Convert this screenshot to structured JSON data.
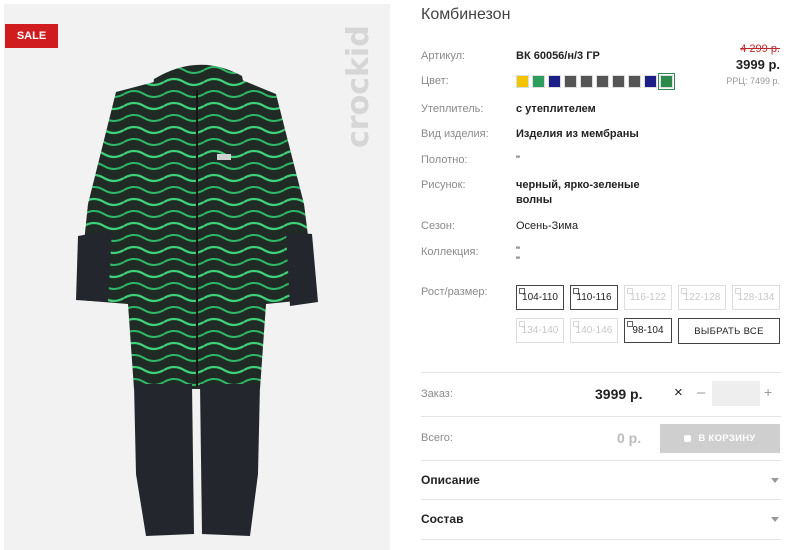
{
  "badge": {
    "sale": "SALE"
  },
  "brand": {
    "logo_text": "crockid"
  },
  "product": {
    "title": "Комбинезон",
    "attributes": [
      {
        "label": "Артикул:",
        "value": "ВК 60056/н/3 ГР"
      },
      {
        "label": "Цвет:",
        "value": ""
      },
      {
        "label": "Утеплитель:",
        "value": "с утеплителем"
      },
      {
        "label": "Вид изделия:",
        "value": "Изделия из мембраны"
      },
      {
        "label": "Полотно:",
        "value": "\""
      },
      {
        "label": "Рисунок:",
        "value_line1": "черный, ярко-зеленые",
        "value_line2": "волны"
      },
      {
        "label": "Сезон:",
        "value": "Осень-Зима"
      },
      {
        "label": "Коллекция:",
        "value_line1": "\"",
        "value_line2": "\""
      }
    ],
    "colors": [
      "#f2c500",
      "#2e9e5e",
      "#1c1f85",
      "#555555",
      "#555555",
      "#555555",
      "#555555",
      "#555555",
      "#1c1f85",
      "#2d8a4e"
    ],
    "active_color_index": 9
  },
  "price": {
    "old": "4 299 р.",
    "current": "3999 р.",
    "rrp": "РРЦ: 7499 р."
  },
  "sizes": {
    "label": "Рост/размер:",
    "row1": [
      {
        "label": "104-110",
        "available": true
      },
      {
        "label": "110-116",
        "available": true
      },
      {
        "label": "116-122",
        "available": false
      },
      {
        "label": "122-128",
        "available": false
      },
      {
        "label": "128-134",
        "available": false
      }
    ],
    "row2": [
      {
        "label": "134-140",
        "available": false
      },
      {
        "label": "140-146",
        "available": false
      },
      {
        "label": "98-104",
        "available": true
      }
    ],
    "select_all": "ВЫБРАТЬ ВСЕ"
  },
  "order": {
    "label": "Заказ:",
    "price": "3999 р.",
    "times": "×",
    "minus": "–",
    "plus": "+",
    "quantity": ""
  },
  "total": {
    "label": "Всего:",
    "value": "0 р.",
    "cart_button": "В КОРЗИНУ"
  },
  "accordions": {
    "description": "Описание",
    "composition": "Состав"
  }
}
